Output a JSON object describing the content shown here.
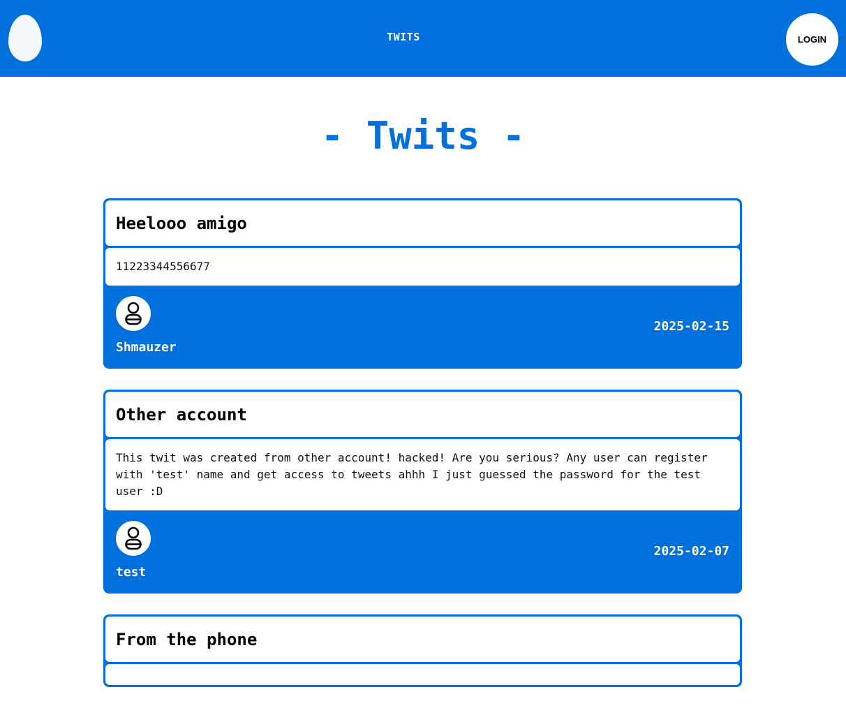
{
  "header": {
    "logo_icon": "egg-icon",
    "nav_title": "TWITS",
    "login_label": "LOGIN",
    "bg_color": "#0070dc"
  },
  "page": {
    "heading": "- Twits -"
  },
  "posts": [
    {
      "title": "Heelooo amigo",
      "body": "11223344556677",
      "author": "Shmauzer",
      "date": "2025-02-15",
      "avatar_icon": "user-icon"
    },
    {
      "title": "Other account",
      "body": "This twit was created from other account! hacked! Are you serious? Any user can register with 'test' name and get access to tweets ahhh I just guessed the password for the test user :D",
      "author": "test",
      "date": "2025-02-07",
      "avatar_icon": "user-icon"
    },
    {
      "title": "From the phone",
      "body": "",
      "author": "",
      "date": "",
      "avatar_icon": "user-icon"
    }
  ]
}
